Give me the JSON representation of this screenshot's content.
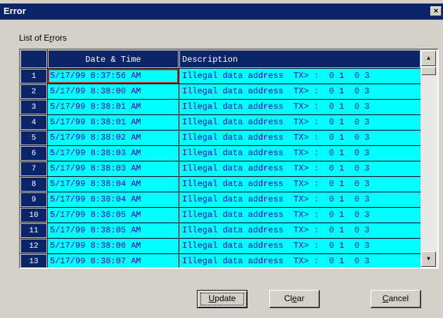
{
  "window": {
    "title": "Error",
    "close_glyph": "×"
  },
  "list_label_prefix": "List of E",
  "list_label_mnemonic": "r",
  "list_label_suffix": "rors",
  "table": {
    "columns": [
      "",
      "Date & Time",
      "Description"
    ],
    "rows": [
      {
        "num": "1",
        "datetime": "5/17/99 8:37:56 AM",
        "description": "Illegal data address  TX> :  0 1  0 3"
      },
      {
        "num": "2",
        "datetime": "5/17/99 8:38:00 AM",
        "description": "Illegal data address  TX> :  0 1  0 3"
      },
      {
        "num": "3",
        "datetime": "5/17/99 8:38:01 AM",
        "description": "Illegal data address  TX> :  0 1  0 3"
      },
      {
        "num": "4",
        "datetime": "5/17/99 8:38:01 AM",
        "description": "Illegal data address  TX> :  0 1  0 3"
      },
      {
        "num": "5",
        "datetime": "5/17/99 8:38:02 AM",
        "description": "Illegal data address  TX> :  0 1  0 3"
      },
      {
        "num": "6",
        "datetime": "5/17/99 8:38:03 AM",
        "description": "Illegal data address  TX> :  0 1  0 3"
      },
      {
        "num": "7",
        "datetime": "5/17/99 8:38:03 AM",
        "description": "Illegal data address  TX> :  0 1  0 3"
      },
      {
        "num": "8",
        "datetime": "5/17/99 8:38:04 AM",
        "description": "Illegal data address  TX> :  0 1  0 3"
      },
      {
        "num": "9",
        "datetime": "5/17/99 8:38:04 AM",
        "description": "Illegal data address  TX> :  0 1  0 3"
      },
      {
        "num": "10",
        "datetime": "5/17/99 8:38:05 AM",
        "description": "Illegal data address  TX> :  0 1  0 3"
      },
      {
        "num": "11",
        "datetime": "5/17/99 8:38:05 AM",
        "description": "Illegal data address  TX> :  0 1  0 3"
      },
      {
        "num": "12",
        "datetime": "5/17/99 8:38:06 AM",
        "description": "Illegal data address  TX> :  0 1  0 3"
      },
      {
        "num": "13",
        "datetime": "5/17/99 8:38:07 AM",
        "description": "Illegal data address  TX> :  0 1  0 3"
      }
    ]
  },
  "scrollbar": {
    "up_glyph": "▲",
    "down_glyph": "▼"
  },
  "buttons": {
    "update": {
      "mnemonic": "U",
      "rest": "pdate"
    },
    "clear": {
      "prefix": "Cl",
      "mnemonic": "e",
      "rest": "ar"
    },
    "cancel": {
      "mnemonic": "C",
      "rest": "ancel"
    }
  },
  "colors": {
    "title_bar": "#0a246a",
    "row_cell": "#00ffff",
    "cell_text": "#0000cc",
    "selection_border": "#b22222",
    "dialog_face": "#d4d0c8"
  }
}
